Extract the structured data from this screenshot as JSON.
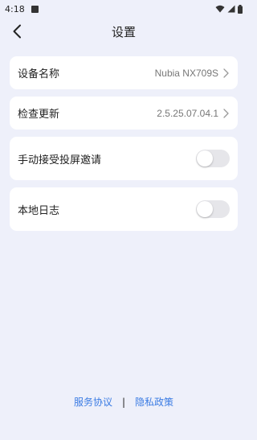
{
  "status_bar": {
    "time": "4:18",
    "icons": [
      "notification-icon",
      "wifi-icon",
      "signal-icon",
      "battery-icon"
    ]
  },
  "header": {
    "title": "设置",
    "back_icon": "chevron-left-icon"
  },
  "settings": {
    "device_name": {
      "label": "设备名称",
      "value": "Nubia NX709S"
    },
    "check_update": {
      "label": "检查更新",
      "value": "2.5.25.07.04.1"
    },
    "manual_accept": {
      "label": "手动接受投屏邀请",
      "enabled": false
    },
    "local_log": {
      "label": "本地日志",
      "enabled": false
    }
  },
  "footer": {
    "service_agreement": "服务协议",
    "separator": "|",
    "privacy_policy": "隐私政策"
  },
  "colors": {
    "background": "#eef0fa",
    "card": "#ffffff",
    "link": "#3a7be3",
    "toggle_off": "#e6e6ea"
  }
}
